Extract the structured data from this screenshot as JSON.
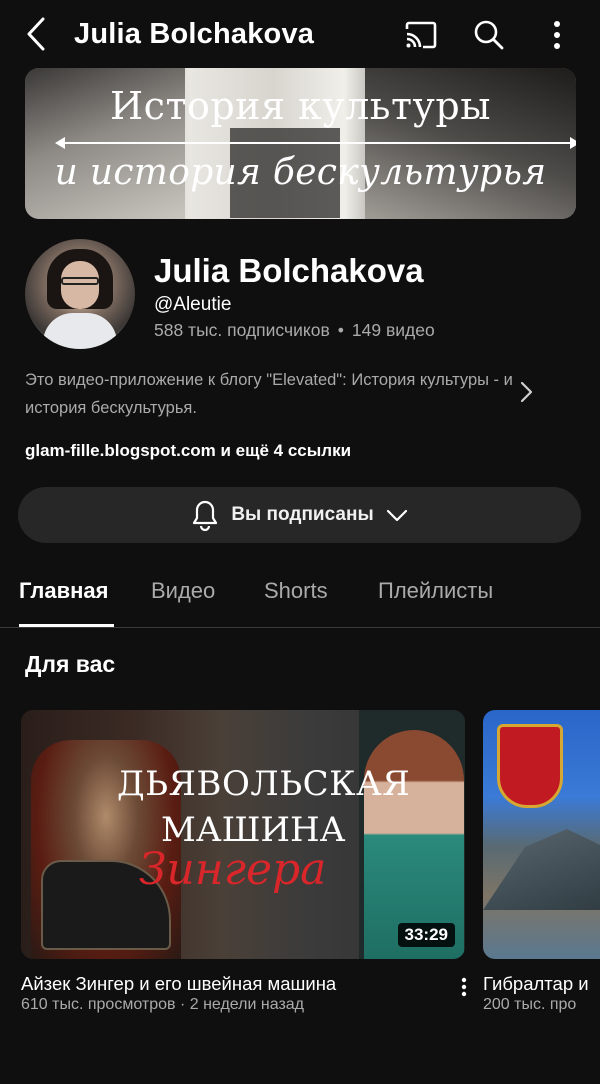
{
  "header": {
    "title": "Julia Bolchakova",
    "icons": {
      "back": "back-arrow-icon",
      "cast": "cast-icon",
      "search": "search-icon",
      "more": "more-vertical-icon"
    }
  },
  "banner": {
    "line1": "История культуры",
    "line2": "и история бескультурья"
  },
  "channel": {
    "name": "Julia Bolchakova",
    "handle": "@Aleutie",
    "subscribers": "588 тыс. подписчиков",
    "dot": "•",
    "videos": "149 видео",
    "description": "Это видео-приложение к блогу \"Elevated\": История культуры - и история бескультурья.",
    "links": "glam-fille.blogspot.com и ещё 4 ссылки"
  },
  "subscribe": {
    "label": "Вы подписаны",
    "icon": "bell-icon",
    "chevron": "chevron-down-icon"
  },
  "tabs": [
    {
      "label": "Главная",
      "active": true
    },
    {
      "label": "Видео",
      "active": false
    },
    {
      "label": "Shorts",
      "active": false
    },
    {
      "label": "Плейлисты",
      "active": false
    }
  ],
  "section": {
    "title": "Для вас"
  },
  "videos": [
    {
      "thumb_line1": "ДЬЯВОЛЬСКАЯ",
      "thumb_line2": "МАШИНА",
      "thumb_line3": "Зингера",
      "duration": "33:29",
      "title": "Айзек Зингер и его швейная машина",
      "views": "610 тыс. просмотров",
      "sep": "·",
      "age": "2 недели назад"
    },
    {
      "title": "Гибралтар и",
      "views": "200 тыс. про"
    }
  ],
  "colors": {
    "background": "#0f0f0f",
    "button_bg": "#272727",
    "secondary_text": "#aaaaaa",
    "thumb_accent_red": "#d8262a"
  }
}
